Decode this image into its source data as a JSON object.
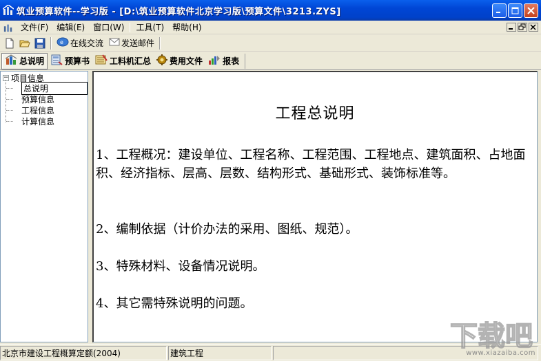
{
  "window": {
    "title": "筑业预算软件--学习版 - [D:\\筑业预算软件北京学习版\\预算文件\\3213.ZYS]"
  },
  "menu": {
    "items": [
      "文件(F)",
      "编辑(E)",
      "窗口(W)",
      "工具(T)",
      "帮助(H)"
    ]
  },
  "toolbar": {
    "online_chat": "在线交流",
    "send_mail": "发送邮件"
  },
  "modules": {
    "items": [
      "总说明",
      "预算书",
      "工料机汇总",
      "费用文件",
      "报表"
    ],
    "active": "总说明"
  },
  "tree": {
    "root": "项目信息",
    "expander": "−",
    "children": [
      "总说明",
      "预算信息",
      "工程信息",
      "计算信息"
    ],
    "selected": "总说明"
  },
  "document": {
    "title": "工程总说明",
    "paragraphs": [
      "1、工程概况：建设单位、工程名称、工程范围、工程地点、建筑面积、占地面积、经济指标、层高、层数、结构形式、基础形式、装饰标准等。",
      "2、编制依据（计价办法的采用、图纸、规范）。",
      "3、特殊材料、设备情况说明。",
      "4、其它需特殊说明的问题。"
    ]
  },
  "status": {
    "quota": "北京市建设工程概算定额(2004)",
    "project_type": "建筑工程"
  },
  "watermark": {
    "logo_text": "下载吧",
    "url": "www.xiazaiba.com"
  },
  "colors": {
    "titlebar": "#0046D5",
    "chrome": "#ECE9D8",
    "border": "#7F9DB9"
  }
}
